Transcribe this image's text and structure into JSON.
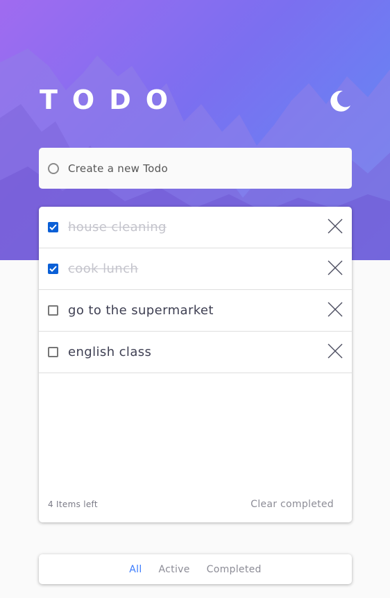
{
  "app": {
    "title": "TODO",
    "theme_icon": "moon-icon"
  },
  "new_todo": {
    "placeholder": "Create a new Todo"
  },
  "todos": [
    {
      "text": "house cleaning",
      "completed": true
    },
    {
      "text": "cook lunch",
      "completed": true
    },
    {
      "text": "go to the supermarket",
      "completed": false
    },
    {
      "text": "english class",
      "completed": false
    }
  ],
  "footer": {
    "items_left": "4 Items left",
    "clear_completed": "Clear completed"
  },
  "filters": [
    {
      "label": "All",
      "active": true
    },
    {
      "label": "Active",
      "active": false
    },
    {
      "label": "Completed",
      "active": false
    }
  ],
  "colors": {
    "accent": "#3a7bfd",
    "checkbox_checked": "#0a5fd6",
    "gradient_start": "#a06bf0",
    "gradient_end": "#5d8ff5"
  }
}
